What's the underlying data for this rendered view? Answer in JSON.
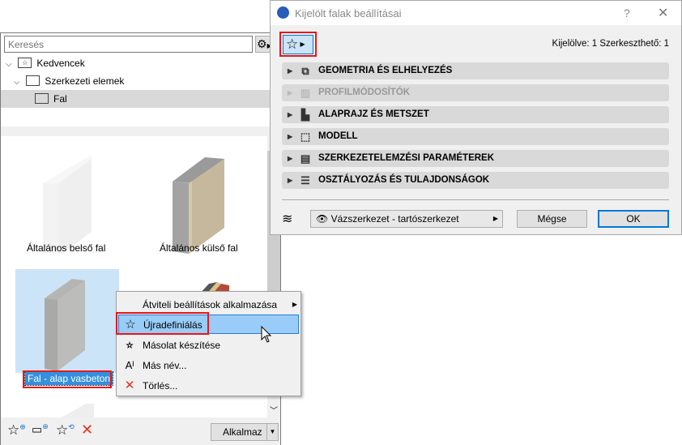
{
  "left_panel": {
    "search_placeholder": "Keresés",
    "tree": [
      {
        "label": "Kedvencek",
        "icon": "favorites-folder-icon"
      },
      {
        "label": "Szerkezeti elemek",
        "icon": "folder-icon"
      },
      {
        "label": "Fal",
        "icon": "folder-icon",
        "selected": true
      }
    ],
    "favorites": [
      {
        "label": "Általános belső fal"
      },
      {
        "label": "Általános külső fal"
      },
      {
        "label": "Fal - alap vasbeton",
        "selected": true
      }
    ],
    "apply_label": "Alkalmaz"
  },
  "dialog": {
    "title": "Kijelölt falak beállításai",
    "help": "?",
    "close": "✕",
    "status": "Kijelölve: 1 Szerkeszthető: 1",
    "sections": [
      {
        "label": "GEOMETRIA ÉS ELHELYEZÉS",
        "enabled": true
      },
      {
        "label": "PROFILMÓDOSÍTÓK",
        "enabled": false
      },
      {
        "label": "ALAPRAJZ ÉS METSZET",
        "enabled": true
      },
      {
        "label": "MODELL",
        "enabled": true
      },
      {
        "label": "SZERKEZETELEMZÉSI PARAMÉTEREK",
        "enabled": true
      },
      {
        "label": "OSZTÁLYOZÁS ÉS TULAJDONSÁGOK",
        "enabled": true
      }
    ],
    "layer_value": "Vázszerkezet - tartószerkezet",
    "cancel_label": "Mégse",
    "ok_label": "OK"
  },
  "context_menu": {
    "items": [
      {
        "label": "Átviteli beállítások alkalmazása"
      },
      {
        "label": "Újradefiniálás",
        "highlighted": true
      },
      {
        "label": "Másolat készítése"
      },
      {
        "label": "Más név..."
      },
      {
        "label": "Törlés..."
      }
    ]
  },
  "colors": {
    "highlight": "#99ccf7",
    "annotation": "#e8161b",
    "delete": "#e8301b",
    "accent": "#0078d7"
  }
}
